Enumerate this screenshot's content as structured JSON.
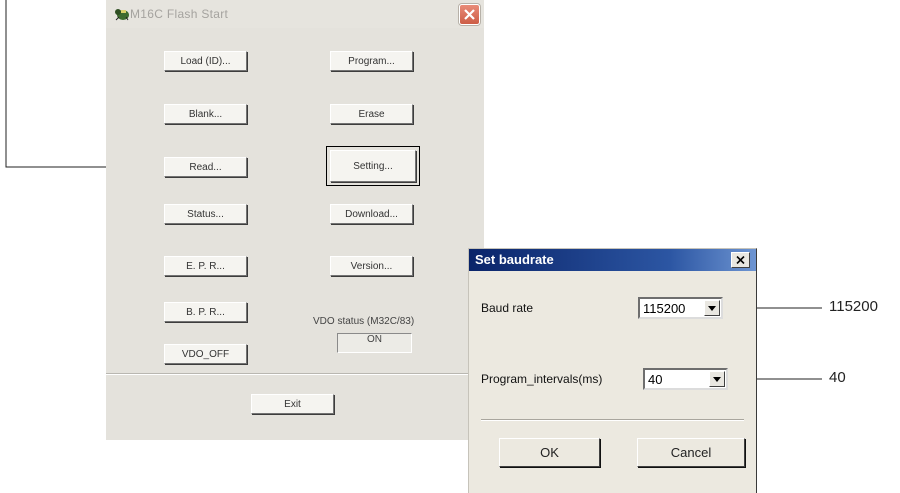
{
  "main_window": {
    "title": "M16C Flash Start",
    "buttons": {
      "load": "Load (ID)...",
      "program": "Program...",
      "blank": "Blank...",
      "erase": "Erase",
      "read": "Read...",
      "setting": "Setting...",
      "status": "Status...",
      "download": "Download...",
      "epr": "E. P. R...",
      "version": "Version...",
      "bpr": "B. P. R...",
      "vdo_off": "VDO_OFF",
      "exit": "Exit"
    },
    "vdo_status_label": "VDO status (M32C/83)",
    "vdo_status_value": "ON"
  },
  "baud_dialog": {
    "title": "Set baudrate",
    "baud_rate_label": "Baud rate",
    "baud_rate_value": "115200",
    "program_intervals_label": "Program_intervals(ms)",
    "program_intervals_value": "40",
    "ok_label": "OK",
    "cancel_label": "Cancel"
  },
  "callouts": {
    "baud_rate": "115200",
    "program_intervals": "40"
  },
  "icons": {
    "app": "bug-icon",
    "close": "close-icon",
    "dropdown": "chevron-down-icon"
  },
  "colors": {
    "dialog_titlebar": "#0a2469",
    "close_button": "#cd5d46",
    "window_face": "#e4e2dc"
  }
}
